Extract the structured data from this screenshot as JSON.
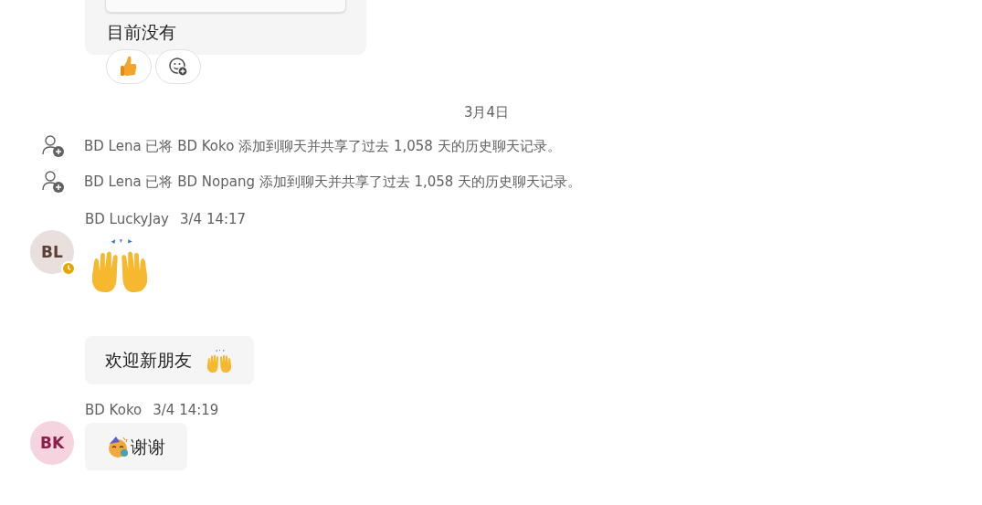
{
  "top_message": {
    "text": "目前没有",
    "reactions": [
      {
        "kind": "thumbs-up"
      },
      {
        "kind": "add-reaction"
      }
    ]
  },
  "date_divider": "3月4日",
  "system_events": [
    {
      "text": "BD Lena 已将 BD Koko 添加到聊天并共享了过去 1,058 天的历史聊天记录。"
    },
    {
      "text": "BD Lena 已将 BD Nopang 添加到聊天并共享了过去 1,058 天的历史聊天记录。"
    }
  ],
  "messages": [
    {
      "sender": "BD LuckyJay",
      "time": "3/4 14:17",
      "avatar": {
        "initials": "BL",
        "color": "#e9e0de",
        "away": true
      },
      "items": [
        {
          "kind": "big-emoji"
        },
        {
          "kind": "text",
          "text": "欢迎新朋友",
          "trailing_emoji": true
        }
      ]
    },
    {
      "sender": "BD Koko",
      "time": "3/4 14:19",
      "avatar": {
        "initials": "BK",
        "color": "#f5d3df"
      },
      "items": [
        {
          "kind": "text",
          "text": "谢谢",
          "leading_emoji": true
        }
      ]
    }
  ]
}
